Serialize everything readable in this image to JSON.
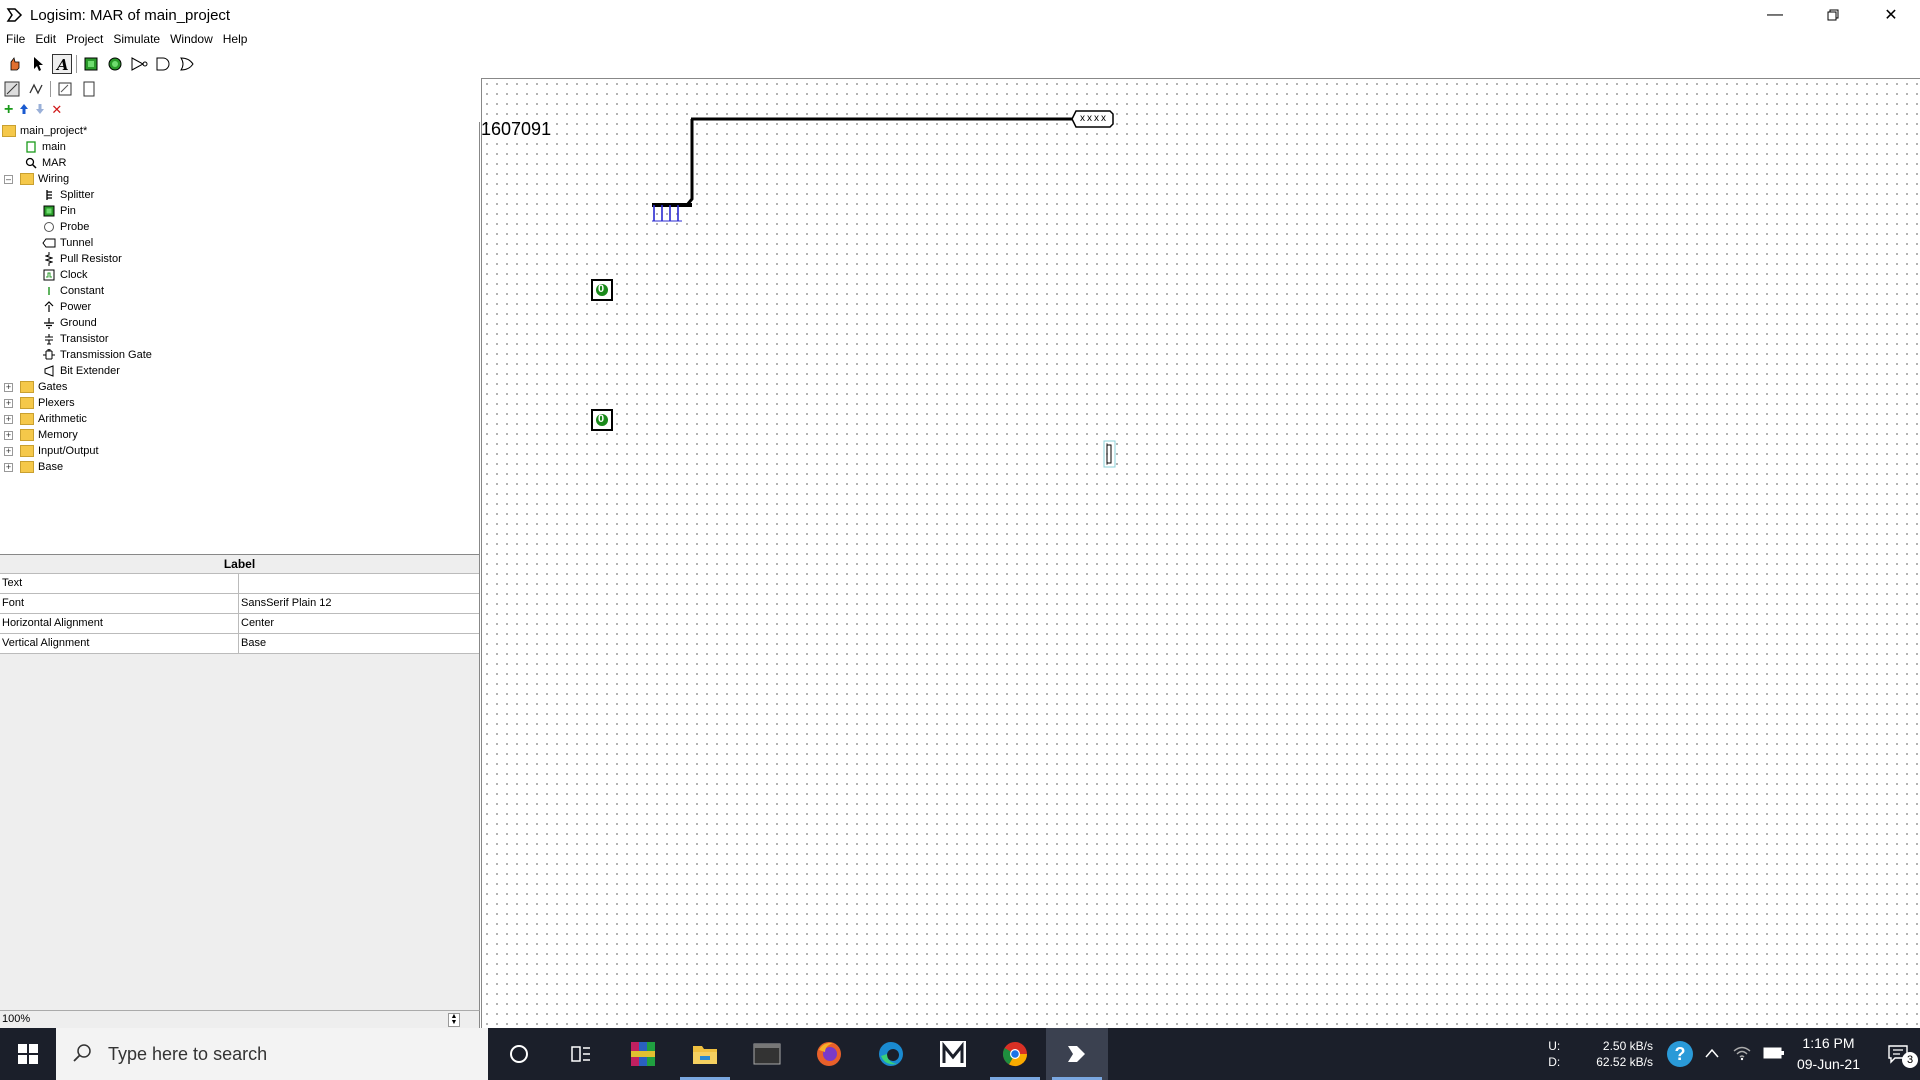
{
  "window": {
    "title": "Logisim: MAR of main_project"
  },
  "menu": [
    "File",
    "Edit",
    "Project",
    "Simulate",
    "Window",
    "Help"
  ],
  "tree": {
    "root": "main_project*",
    "circuits": [
      "main",
      "MAR"
    ],
    "wiring_folder": "Wiring",
    "wiring_items": [
      "Splitter",
      "Pin",
      "Probe",
      "Tunnel",
      "Pull Resistor",
      "Clock",
      "Constant",
      "Power",
      "Ground",
      "Transistor",
      "Transmission Gate",
      "Bit Extender"
    ],
    "libraries": [
      "Gates",
      "Plexers",
      "Arithmetic",
      "Memory",
      "Input/Output",
      "Base"
    ]
  },
  "attributes": {
    "title": "Label",
    "rows": [
      {
        "key": "Text",
        "value": ""
      },
      {
        "key": "Font",
        "value": "SansSerif Plain 12"
      },
      {
        "key": "Horizontal Alignment",
        "value": "Center"
      },
      {
        "key": "Vertical Alignment",
        "value": "Base"
      }
    ]
  },
  "zoom": "100%",
  "canvas": {
    "text_label": "1607091",
    "tunnel_value": "xxxx",
    "pin1_value": "0",
    "pin2_value": "0"
  },
  "taskbar": {
    "search_placeholder": "Type here to search",
    "net_up_label": "U:",
    "net_up": "2.50 kB/s",
    "net_down_label": "D:",
    "net_down": "62.52 kB/s",
    "time": "1:16 PM",
    "date": "09-Jun-21",
    "notifications": "3"
  },
  "colors": {
    "wire": "#000000",
    "pin_green": "#1a8a1a",
    "splitter_blue": "#2a2ad0",
    "folder": "#f5c84a",
    "taskbar": "#1b1f2a"
  }
}
